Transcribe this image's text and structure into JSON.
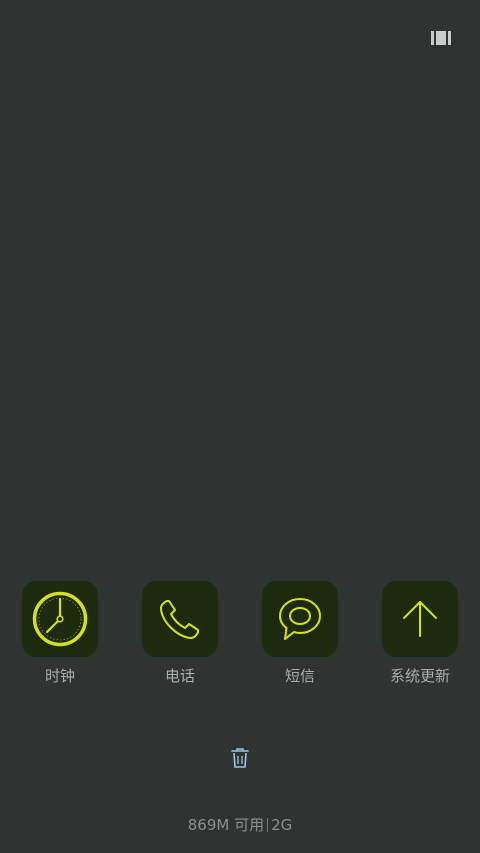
{
  "colors": {
    "background": "#2f3432",
    "tile_background": "#1d2a0e",
    "accent": "#d4e21a",
    "label_text": "#a9acaa",
    "status_text": "#8c8f8d",
    "trash_icon": "#9fc7e6"
  },
  "header": {
    "view_toggle_icon": "recents-view-toggle-icon"
  },
  "apps": [
    {
      "label": "时钟",
      "icon": "clock-icon"
    },
    {
      "label": "电话",
      "icon": "phone-icon"
    },
    {
      "label": "短信",
      "icon": "message-bubble-icon"
    },
    {
      "label": "系统更新",
      "icon": "arrow-up-icon"
    }
  ],
  "clear_all": {
    "icon": "trash-icon"
  },
  "memory": {
    "available": "869M 可用",
    "total": "2G"
  }
}
